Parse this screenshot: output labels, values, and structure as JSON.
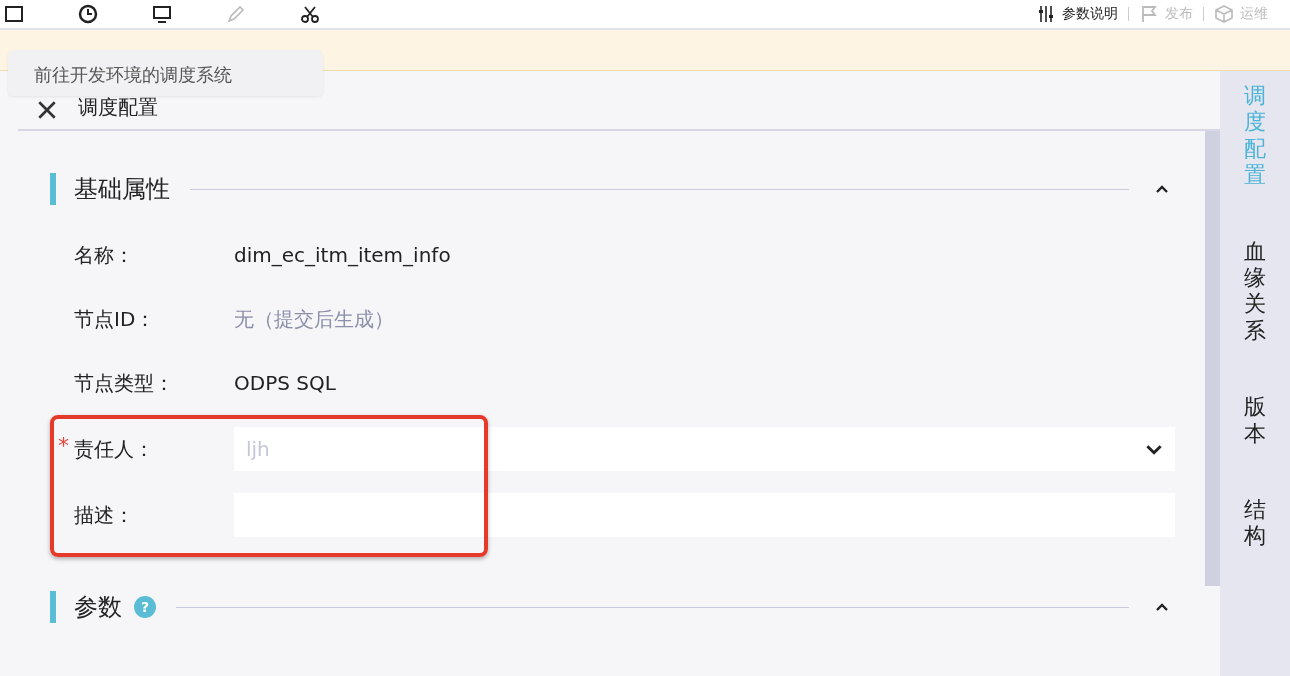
{
  "toolbar": {
    "right_items": [
      {
        "label": "参数说明",
        "disabled": false
      },
      {
        "label": "发布",
        "disabled": true
      },
      {
        "label": "运维",
        "disabled": true
      }
    ]
  },
  "tooltip": {
    "text": "前往开发环境的调度系统"
  },
  "panel": {
    "title": "调度配置",
    "sections": [
      {
        "title": "基础属性",
        "expanded": true,
        "fields": [
          {
            "kind": "text",
            "label": "名称：",
            "value": "dim_ec_itm_item_info",
            "muted": false
          },
          {
            "kind": "text",
            "label": "节点ID：",
            "value": "无（提交后生成）",
            "muted": true
          },
          {
            "kind": "text",
            "label": "节点类型：",
            "value": "ODPS SQL",
            "muted": false
          },
          {
            "kind": "select",
            "label": "责任人：",
            "value": "ljh",
            "required_mark": "*",
            "disabled": true,
            "highlighted": true
          },
          {
            "kind": "input",
            "label": "描述：",
            "highlighted": true
          }
        ]
      },
      {
        "title": "参数",
        "help_icon": "?",
        "expanded": true
      }
    ]
  },
  "side_tabs": [
    {
      "label": "调度配置",
      "selected": true
    },
    {
      "label": "血缘关系",
      "selected": false
    },
    {
      "label": "版本",
      "selected": false
    },
    {
      "label": "结构",
      "selected": false
    }
  ]
}
